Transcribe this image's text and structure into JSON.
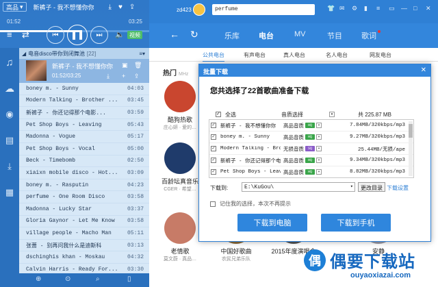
{
  "player": {
    "quality": "高品",
    "now_title": "新裤子 - 我不想懂你你",
    "time_current": "01:52",
    "time_total": "03:25",
    "progress_fraction": 0.55,
    "hq_badge": "视频",
    "icons": [
      "download-icon",
      "heart-icon",
      "share-icon"
    ]
  },
  "sidebar_icons": [
    "music-note-icon",
    "cloud-icon",
    "radio-icon",
    "document-icon",
    "download-icon",
    "apps-icon"
  ],
  "playlist": {
    "name": "电音disco带你到闭舞池",
    "count": "[22]",
    "current": {
      "title": "新裤子 - 我不想懂你你",
      "time": "01:52/03:25"
    },
    "items": [
      {
        "name": "boney m. - Sunny",
        "dur": "04:03"
      },
      {
        "name": "Modern Talking - Brother ...",
        "dur": "03:45"
      },
      {
        "name": "新裤子 - 你还记得那个电影...",
        "dur": "03:59"
      },
      {
        "name": "Pet Shop Boys - Leaving",
        "dur": "05:43"
      },
      {
        "name": "Madonna - Vogue",
        "dur": "05:17"
      },
      {
        "name": "Pet Shop Boys - Vocal",
        "dur": "05:00"
      },
      {
        "name": "Beck - Timebomb",
        "dur": "02:50"
      },
      {
        "name": "xiaixn mobile disco - Hot...",
        "dur": "03:09"
      },
      {
        "name": "boney m. - Rasputin",
        "dur": "04:23"
      },
      {
        "name": "perfume - One Room Disco",
        "dur": "03:58"
      },
      {
        "name": "Madonna - Lucky Star",
        "dur": "03:37"
      },
      {
        "name": "Gloria Gaynor - Let Me Know",
        "dur": "03:58"
      },
      {
        "name": "village people - Macho Man",
        "dur": "05:11"
      },
      {
        "name": "张蔷 - 别再问我什么是迪斯科",
        "dur": "03:13"
      },
      {
        "name": "dschinghis khan - Moskau",
        "dur": "04:32"
      },
      {
        "name": "Calvin Harris - Ready For...",
        "dur": "03:30"
      }
    ]
  },
  "titlebar": {
    "user": "zd423",
    "search": "perfume"
  },
  "nav": {
    "tabs": [
      "乐库",
      "电台",
      "MV",
      "节目",
      "歌词"
    ],
    "active": "电台"
  },
  "subtabs": [
    "公共电台",
    "有声电台",
    "真人电台",
    "名人电台",
    "网友电台"
  ],
  "content": {
    "hot_title": "热门",
    "hot_sub": "MHz",
    "stations": [
      {
        "title": "酷狗热歌",
        "sub": "庄心妍 · 爱的… ",
        "color": "#c9462f"
      },
      {
        "title": "百龄坛真音乐",
        "sub": "CGER · 希望…",
        "color": "#1f3b6b"
      },
      {
        "title": "老情歌",
        "sub": "莫文蔚 · 真品…",
        "color": "#c77b67"
      },
      {
        "title": "中国好歌曲",
        "sub": "农民兄弟乐队",
        "color": "#8a6a3a"
      },
      {
        "title": "2015年度演唱会",
        "sub": "",
        "color": "#555"
      },
      {
        "title": "安静",
        "sub": "",
        "color": "#9a9aa5"
      }
    ]
  },
  "dialog": {
    "title": "批量下载",
    "heading": "您共选择了22首歌曲准备下载",
    "col_all": "全选",
    "col_quality": "音质选择",
    "col_total": "共 225.87 MB",
    "rows": [
      {
        "name": "新裤子 - 我不想懂你你",
        "quality": "高品音质",
        "badge": "HQ",
        "badge_color": "#3aa54a",
        "size": "7.84MB/320kbps/mp3"
      },
      {
        "name": "boney m. - Sunny",
        "quality": "高品音质",
        "badge": "HQ",
        "badge_color": "#3aa54a",
        "size": "9.27MB/320kbps/mp3"
      },
      {
        "name": "Modern Talking - Brothe",
        "quality": "无损音质",
        "badge": "SQ",
        "badge_color": "#8b5cc9",
        "size": "25.44MB/无损/ape"
      },
      {
        "name": "新裤子 - 你还记得那个电影",
        "quality": "高品音质",
        "badge": "HQ",
        "badge_color": "#3aa54a",
        "size": "9.34MB/320kbps/mp3"
      },
      {
        "name": "Pet Shop Boys - Leaving",
        "quality": "高品音质",
        "badge": "HQ",
        "badge_color": "#3aa54a",
        "size": "8.82MB/320kbps/mp3"
      }
    ],
    "path_label": "下载到:",
    "path": "E:\\KuGou\\",
    "change_dir": "更改目录",
    "settings": "下载设置",
    "remember": "记住我的选择，本次不再提示",
    "btn_pc": "下载到电脑",
    "btn_phone": "下载到手机"
  },
  "watermark": {
    "logo": "偶",
    "text": "偶要下载站",
    "url": "ouyaoxiazai.com"
  },
  "colors": {
    "brand_blue": "#2f80d5",
    "playlist_bg": "#d7e8f7",
    "button_blue": "#2f86dd"
  }
}
